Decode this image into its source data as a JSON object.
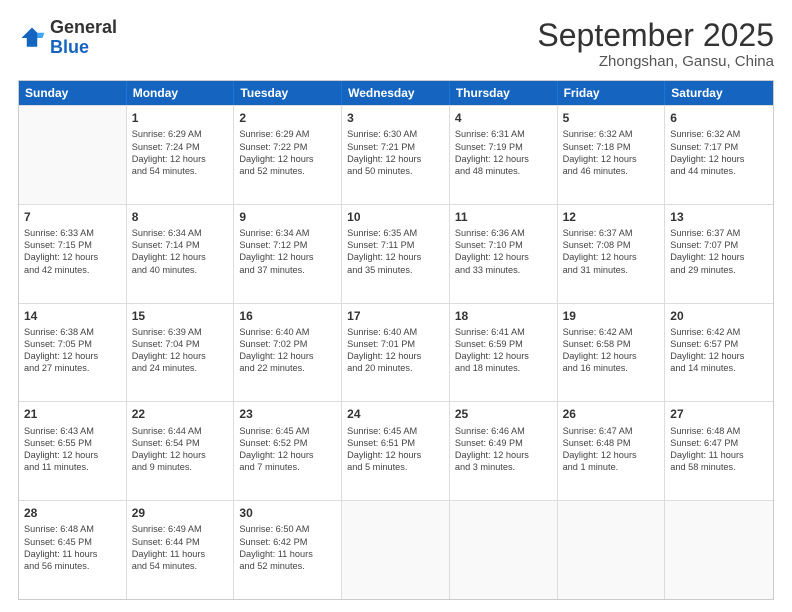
{
  "logo": {
    "general": "General",
    "blue": "Blue"
  },
  "header": {
    "month": "September 2025",
    "location": "Zhongshan, Gansu, China"
  },
  "weekdays": [
    "Sunday",
    "Monday",
    "Tuesday",
    "Wednesday",
    "Thursday",
    "Friday",
    "Saturday"
  ],
  "rows": [
    [
      {
        "day": "",
        "lines": []
      },
      {
        "day": "1",
        "lines": [
          "Sunrise: 6:29 AM",
          "Sunset: 7:24 PM",
          "Daylight: 12 hours",
          "and 54 minutes."
        ]
      },
      {
        "day": "2",
        "lines": [
          "Sunrise: 6:29 AM",
          "Sunset: 7:22 PM",
          "Daylight: 12 hours",
          "and 52 minutes."
        ]
      },
      {
        "day": "3",
        "lines": [
          "Sunrise: 6:30 AM",
          "Sunset: 7:21 PM",
          "Daylight: 12 hours",
          "and 50 minutes."
        ]
      },
      {
        "day": "4",
        "lines": [
          "Sunrise: 6:31 AM",
          "Sunset: 7:19 PM",
          "Daylight: 12 hours",
          "and 48 minutes."
        ]
      },
      {
        "day": "5",
        "lines": [
          "Sunrise: 6:32 AM",
          "Sunset: 7:18 PM",
          "Daylight: 12 hours",
          "and 46 minutes."
        ]
      },
      {
        "day": "6",
        "lines": [
          "Sunrise: 6:32 AM",
          "Sunset: 7:17 PM",
          "Daylight: 12 hours",
          "and 44 minutes."
        ]
      }
    ],
    [
      {
        "day": "7",
        "lines": [
          "Sunrise: 6:33 AM",
          "Sunset: 7:15 PM",
          "Daylight: 12 hours",
          "and 42 minutes."
        ]
      },
      {
        "day": "8",
        "lines": [
          "Sunrise: 6:34 AM",
          "Sunset: 7:14 PM",
          "Daylight: 12 hours",
          "and 40 minutes."
        ]
      },
      {
        "day": "9",
        "lines": [
          "Sunrise: 6:34 AM",
          "Sunset: 7:12 PM",
          "Daylight: 12 hours",
          "and 37 minutes."
        ]
      },
      {
        "day": "10",
        "lines": [
          "Sunrise: 6:35 AM",
          "Sunset: 7:11 PM",
          "Daylight: 12 hours",
          "and 35 minutes."
        ]
      },
      {
        "day": "11",
        "lines": [
          "Sunrise: 6:36 AM",
          "Sunset: 7:10 PM",
          "Daylight: 12 hours",
          "and 33 minutes."
        ]
      },
      {
        "day": "12",
        "lines": [
          "Sunrise: 6:37 AM",
          "Sunset: 7:08 PM",
          "Daylight: 12 hours",
          "and 31 minutes."
        ]
      },
      {
        "day": "13",
        "lines": [
          "Sunrise: 6:37 AM",
          "Sunset: 7:07 PM",
          "Daylight: 12 hours",
          "and 29 minutes."
        ]
      }
    ],
    [
      {
        "day": "14",
        "lines": [
          "Sunrise: 6:38 AM",
          "Sunset: 7:05 PM",
          "Daylight: 12 hours",
          "and 27 minutes."
        ]
      },
      {
        "day": "15",
        "lines": [
          "Sunrise: 6:39 AM",
          "Sunset: 7:04 PM",
          "Daylight: 12 hours",
          "and 24 minutes."
        ]
      },
      {
        "day": "16",
        "lines": [
          "Sunrise: 6:40 AM",
          "Sunset: 7:02 PM",
          "Daylight: 12 hours",
          "and 22 minutes."
        ]
      },
      {
        "day": "17",
        "lines": [
          "Sunrise: 6:40 AM",
          "Sunset: 7:01 PM",
          "Daylight: 12 hours",
          "and 20 minutes."
        ]
      },
      {
        "day": "18",
        "lines": [
          "Sunrise: 6:41 AM",
          "Sunset: 6:59 PM",
          "Daylight: 12 hours",
          "and 18 minutes."
        ]
      },
      {
        "day": "19",
        "lines": [
          "Sunrise: 6:42 AM",
          "Sunset: 6:58 PM",
          "Daylight: 12 hours",
          "and 16 minutes."
        ]
      },
      {
        "day": "20",
        "lines": [
          "Sunrise: 6:42 AM",
          "Sunset: 6:57 PM",
          "Daylight: 12 hours",
          "and 14 minutes."
        ]
      }
    ],
    [
      {
        "day": "21",
        "lines": [
          "Sunrise: 6:43 AM",
          "Sunset: 6:55 PM",
          "Daylight: 12 hours",
          "and 11 minutes."
        ]
      },
      {
        "day": "22",
        "lines": [
          "Sunrise: 6:44 AM",
          "Sunset: 6:54 PM",
          "Daylight: 12 hours",
          "and 9 minutes."
        ]
      },
      {
        "day": "23",
        "lines": [
          "Sunrise: 6:45 AM",
          "Sunset: 6:52 PM",
          "Daylight: 12 hours",
          "and 7 minutes."
        ]
      },
      {
        "day": "24",
        "lines": [
          "Sunrise: 6:45 AM",
          "Sunset: 6:51 PM",
          "Daylight: 12 hours",
          "and 5 minutes."
        ]
      },
      {
        "day": "25",
        "lines": [
          "Sunrise: 6:46 AM",
          "Sunset: 6:49 PM",
          "Daylight: 12 hours",
          "and 3 minutes."
        ]
      },
      {
        "day": "26",
        "lines": [
          "Sunrise: 6:47 AM",
          "Sunset: 6:48 PM",
          "Daylight: 12 hours",
          "and 1 minute."
        ]
      },
      {
        "day": "27",
        "lines": [
          "Sunrise: 6:48 AM",
          "Sunset: 6:47 PM",
          "Daylight: 11 hours",
          "and 58 minutes."
        ]
      }
    ],
    [
      {
        "day": "28",
        "lines": [
          "Sunrise: 6:48 AM",
          "Sunset: 6:45 PM",
          "Daylight: 11 hours",
          "and 56 minutes."
        ]
      },
      {
        "day": "29",
        "lines": [
          "Sunrise: 6:49 AM",
          "Sunset: 6:44 PM",
          "Daylight: 11 hours",
          "and 54 minutes."
        ]
      },
      {
        "day": "30",
        "lines": [
          "Sunrise: 6:50 AM",
          "Sunset: 6:42 PM",
          "Daylight: 11 hours",
          "and 52 minutes."
        ]
      },
      {
        "day": "",
        "lines": []
      },
      {
        "day": "",
        "lines": []
      },
      {
        "day": "",
        "lines": []
      },
      {
        "day": "",
        "lines": []
      }
    ]
  ]
}
